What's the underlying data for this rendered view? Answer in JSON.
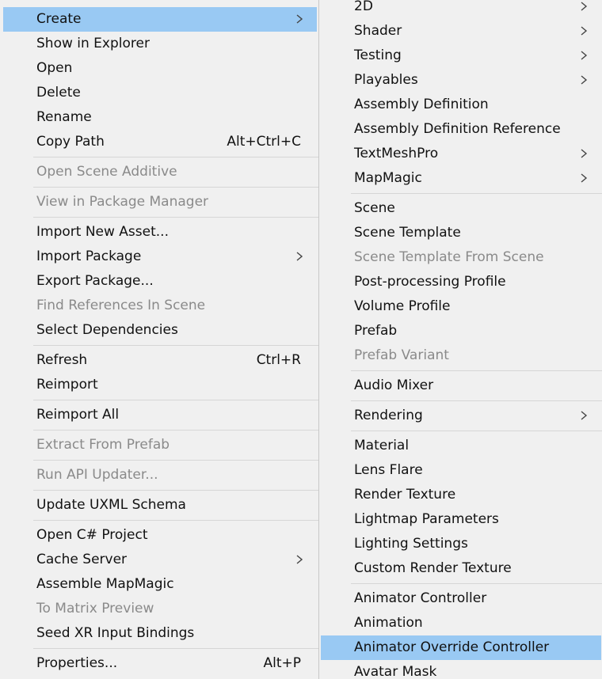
{
  "left_menu": {
    "items": [
      {
        "label": "Create",
        "shortcut": "",
        "submenu": true,
        "disabled": false,
        "selected": true
      },
      {
        "label": "Show in Explorer",
        "shortcut": "",
        "submenu": false,
        "disabled": false,
        "selected": false
      },
      {
        "label": "Open",
        "shortcut": "",
        "submenu": false,
        "disabled": false,
        "selected": false
      },
      {
        "label": "Delete",
        "shortcut": "",
        "submenu": false,
        "disabled": false,
        "selected": false
      },
      {
        "label": "Rename",
        "shortcut": "",
        "submenu": false,
        "disabled": false,
        "selected": false
      },
      {
        "label": "Copy Path",
        "shortcut": "Alt+Ctrl+C",
        "submenu": false,
        "disabled": false,
        "selected": false
      },
      {
        "separator": true
      },
      {
        "label": "Open Scene Additive",
        "shortcut": "",
        "submenu": false,
        "disabled": true,
        "selected": false
      },
      {
        "separator": true
      },
      {
        "label": "View in Package Manager",
        "shortcut": "",
        "submenu": false,
        "disabled": true,
        "selected": false
      },
      {
        "separator": true
      },
      {
        "label": "Import New Asset...",
        "shortcut": "",
        "submenu": false,
        "disabled": false,
        "selected": false
      },
      {
        "label": "Import Package",
        "shortcut": "",
        "submenu": true,
        "disabled": false,
        "selected": false
      },
      {
        "label": "Export Package...",
        "shortcut": "",
        "submenu": false,
        "disabled": false,
        "selected": false
      },
      {
        "label": "Find References In Scene",
        "shortcut": "",
        "submenu": false,
        "disabled": true,
        "selected": false
      },
      {
        "label": "Select Dependencies",
        "shortcut": "",
        "submenu": false,
        "disabled": false,
        "selected": false
      },
      {
        "separator": true
      },
      {
        "label": "Refresh",
        "shortcut": "Ctrl+R",
        "submenu": false,
        "disabled": false,
        "selected": false
      },
      {
        "label": "Reimport",
        "shortcut": "",
        "submenu": false,
        "disabled": false,
        "selected": false
      },
      {
        "separator": true
      },
      {
        "label": "Reimport All",
        "shortcut": "",
        "submenu": false,
        "disabled": false,
        "selected": false
      },
      {
        "separator": true
      },
      {
        "label": "Extract From Prefab",
        "shortcut": "",
        "submenu": false,
        "disabled": true,
        "selected": false
      },
      {
        "separator": true
      },
      {
        "label": "Run API Updater...",
        "shortcut": "",
        "submenu": false,
        "disabled": true,
        "selected": false
      },
      {
        "separator": true
      },
      {
        "label": "Update UXML Schema",
        "shortcut": "",
        "submenu": false,
        "disabled": false,
        "selected": false
      },
      {
        "separator": true
      },
      {
        "label": "Open C# Project",
        "shortcut": "",
        "submenu": false,
        "disabled": false,
        "selected": false
      },
      {
        "label": "Cache Server",
        "shortcut": "",
        "submenu": true,
        "disabled": false,
        "selected": false
      },
      {
        "label": "Assemble MapMagic",
        "shortcut": "",
        "submenu": false,
        "disabled": false,
        "selected": false
      },
      {
        "label": "To Matrix Preview",
        "shortcut": "",
        "submenu": false,
        "disabled": true,
        "selected": false
      },
      {
        "label": "Seed XR Input Bindings",
        "shortcut": "",
        "submenu": false,
        "disabled": false,
        "selected": false
      },
      {
        "separator": true
      },
      {
        "label": "Properties...",
        "shortcut": "Alt+P",
        "submenu": false,
        "disabled": false,
        "selected": false
      }
    ]
  },
  "right_menu": {
    "items": [
      {
        "label": "2D",
        "submenu": true,
        "disabled": false,
        "selected": false
      },
      {
        "label": "Shader",
        "submenu": true,
        "disabled": false,
        "selected": false
      },
      {
        "label": "Testing",
        "submenu": true,
        "disabled": false,
        "selected": false
      },
      {
        "label": "Playables",
        "submenu": true,
        "disabled": false,
        "selected": false
      },
      {
        "label": "Assembly Definition",
        "submenu": false,
        "disabled": false,
        "selected": false
      },
      {
        "label": "Assembly Definition Reference",
        "submenu": false,
        "disabled": false,
        "selected": false
      },
      {
        "label": "TextMeshPro",
        "submenu": true,
        "disabled": false,
        "selected": false
      },
      {
        "label": "MapMagic",
        "submenu": true,
        "disabled": false,
        "selected": false
      },
      {
        "separator": true
      },
      {
        "label": "Scene",
        "submenu": false,
        "disabled": false,
        "selected": false
      },
      {
        "label": "Scene Template",
        "submenu": false,
        "disabled": false,
        "selected": false
      },
      {
        "label": "Scene Template From Scene",
        "submenu": false,
        "disabled": true,
        "selected": false
      },
      {
        "label": "Post-processing Profile",
        "submenu": false,
        "disabled": false,
        "selected": false
      },
      {
        "label": "Volume Profile",
        "submenu": false,
        "disabled": false,
        "selected": false
      },
      {
        "label": "Prefab",
        "submenu": false,
        "disabled": false,
        "selected": false
      },
      {
        "label": "Prefab Variant",
        "submenu": false,
        "disabled": true,
        "selected": false
      },
      {
        "separator": true
      },
      {
        "label": "Audio Mixer",
        "submenu": false,
        "disabled": false,
        "selected": false
      },
      {
        "separator": true
      },
      {
        "label": "Rendering",
        "submenu": true,
        "disabled": false,
        "selected": false
      },
      {
        "separator": true
      },
      {
        "label": "Material",
        "submenu": false,
        "disabled": false,
        "selected": false
      },
      {
        "label": "Lens Flare",
        "submenu": false,
        "disabled": false,
        "selected": false
      },
      {
        "label": "Render Texture",
        "submenu": false,
        "disabled": false,
        "selected": false
      },
      {
        "label": "Lightmap Parameters",
        "submenu": false,
        "disabled": false,
        "selected": false
      },
      {
        "label": "Lighting Settings",
        "submenu": false,
        "disabled": false,
        "selected": false
      },
      {
        "label": "Custom Render Texture",
        "submenu": false,
        "disabled": false,
        "selected": false
      },
      {
        "separator": true
      },
      {
        "label": "Animator Controller",
        "submenu": false,
        "disabled": false,
        "selected": false
      },
      {
        "label": "Animation",
        "submenu": false,
        "disabled": false,
        "selected": false
      },
      {
        "label": "Animator Override Controller",
        "submenu": false,
        "disabled": false,
        "selected": true
      },
      {
        "label": "Avatar Mask",
        "submenu": false,
        "disabled": false,
        "selected": false
      }
    ]
  },
  "icons": {
    "submenu_arrow": "chevron-right-icon"
  },
  "colors": {
    "menu_bg": "#f0f0f0",
    "highlight": "#99c9f3",
    "text": "#111111",
    "disabled_text": "#8a8a8a",
    "separator": "#d6d6d6"
  }
}
